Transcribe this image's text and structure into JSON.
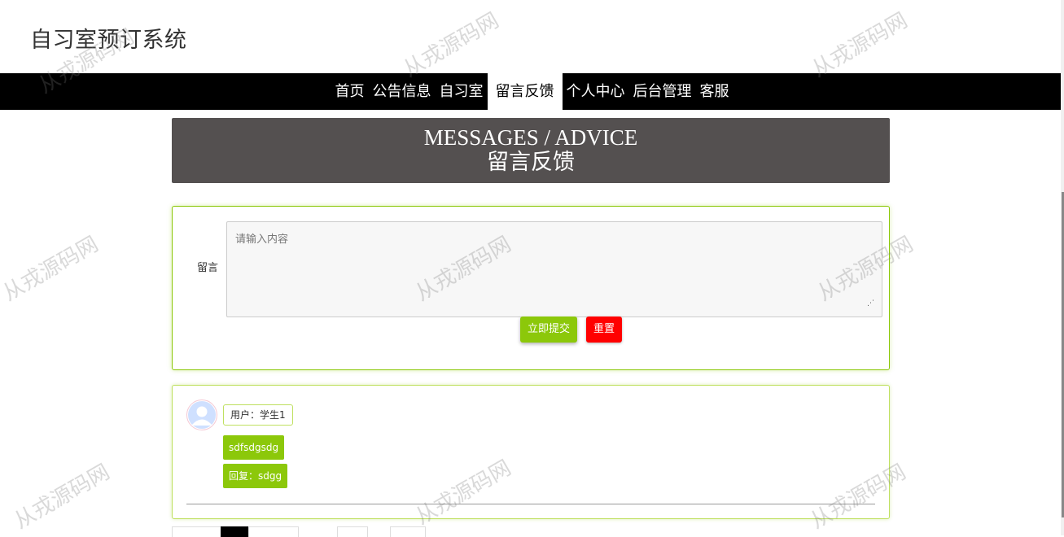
{
  "site": {
    "title": "自习室预订系统"
  },
  "nav": {
    "items": [
      "首页",
      "公告信息",
      "自习室",
      "留言反馈",
      "个人中心",
      "后台管理",
      "客服"
    ],
    "active": "留言反馈"
  },
  "banner": {
    "title_en": "MESSAGES / ADVICE",
    "title_cn": "留言反馈"
  },
  "form": {
    "label": "留言",
    "placeholder": "请输入内容",
    "value": "",
    "submit_label": "立即提交",
    "reset_label": "重置"
  },
  "messages": [
    {
      "user": "用户：学生1",
      "content": "sdfsdgsdg",
      "reply": "回复：sdgg"
    }
  ],
  "watermark": "从戎源码网",
  "colors": {
    "nav_bg": "#000000",
    "banner_bg": "#545050",
    "accent_green": "#8cc80a",
    "reset_red": "#ff0000"
  }
}
